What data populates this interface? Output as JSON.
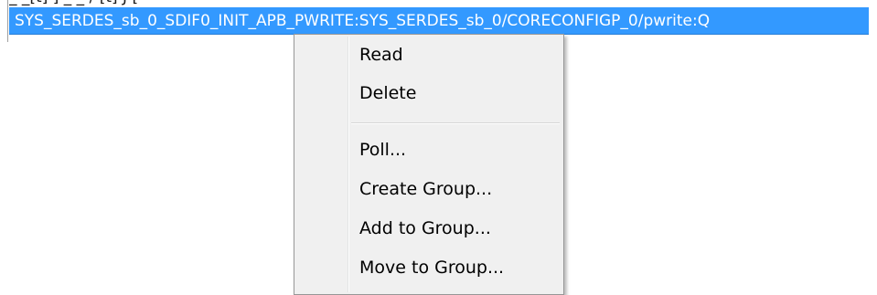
{
  "list": {
    "previous_row_partial": "_ _[t] ] _ _ / [t] J [",
    "selected_row": "SYS_SERDES_sb_0_SDIF0_INIT_APB_PWRITE:SYS_SERDES_sb_0/CORECONFIGP_0/pwrite:Q"
  },
  "context_menu": {
    "items": [
      {
        "label": "Read"
      },
      {
        "label": "Delete"
      },
      {
        "label": "Poll..."
      },
      {
        "label": "Create Group..."
      },
      {
        "label": "Add to Group..."
      },
      {
        "label": "Move to Group..."
      }
    ]
  },
  "colors": {
    "selection": "#3399ff",
    "menu_background": "#f0f0f0",
    "menu_border": "#979797"
  }
}
